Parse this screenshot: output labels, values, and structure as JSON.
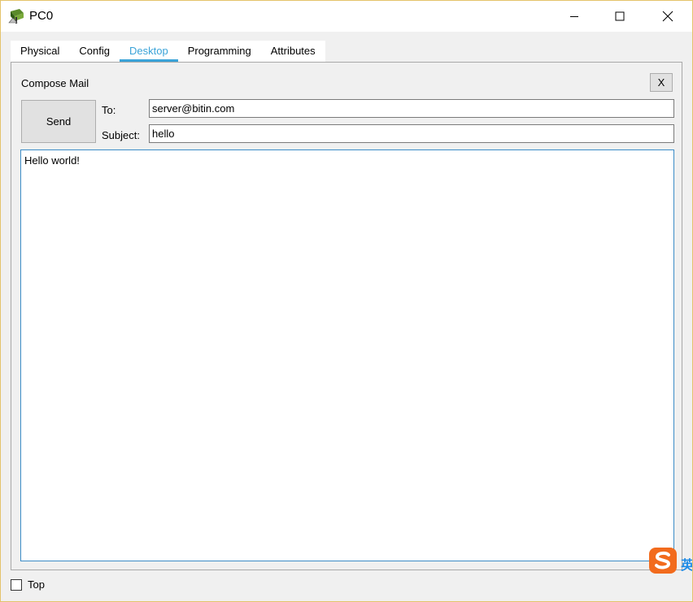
{
  "window": {
    "title": "PC0"
  },
  "tabs": [
    {
      "label": "Physical",
      "active": false
    },
    {
      "label": "Config",
      "active": false
    },
    {
      "label": "Desktop",
      "active": true
    },
    {
      "label": "Programming",
      "active": false
    },
    {
      "label": "Attributes",
      "active": false
    }
  ],
  "compose": {
    "title": "Compose Mail",
    "close_label": "X",
    "send_label": "Send",
    "to_label": "To:",
    "to_value": "server@bitin.com",
    "subject_label": "Subject:",
    "subject_value": "hello",
    "body_value": "Hello world!"
  },
  "footer": {
    "top_label": "Top",
    "top_checked": false
  },
  "ime": {
    "char": "英"
  },
  "colors": {
    "accent": "#3aa3d8",
    "window_border": "#e4c36b",
    "ime_orange": "#f26b1d"
  }
}
